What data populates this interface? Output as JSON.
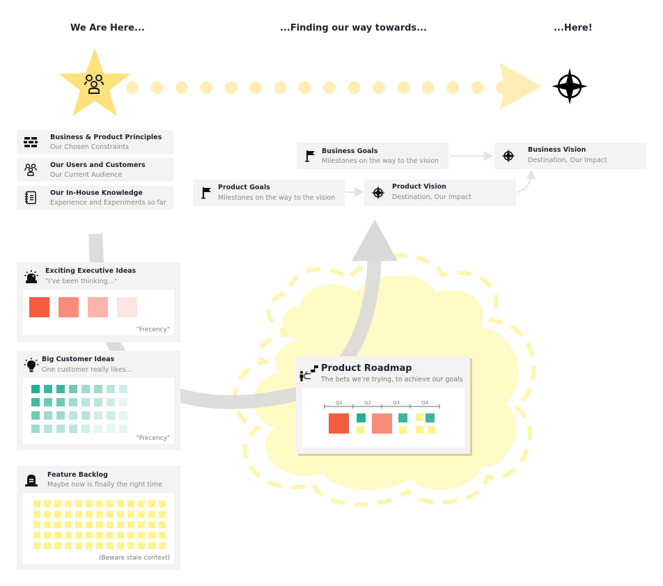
{
  "headings": {
    "left": "We Are Here...",
    "middle": "...Finding our way towards...",
    "right": "...Here!"
  },
  "icons": {
    "start": "group-of-people-icon",
    "destination": "compass-rose-icon"
  },
  "colors": {
    "star": "#fde17a",
    "dots": "#fdeeb6",
    "cloud": "#fffac6",
    "cloud_dash": "#fff5ad",
    "card_bg": "#f3f3f3",
    "gray_arrow": "#d9d9d9",
    "exec_red": "#f55b3f",
    "teal": "#22ae92",
    "backlog_yellow": "#fff48c"
  },
  "context_cards": [
    {
      "icon": "brick-wall-icon",
      "title": "Business & Product Principles",
      "subtitle": "Our Chosen Constraints"
    },
    {
      "icon": "users-icon",
      "title": "Our Users and Customers",
      "subtitle": "Our Current Audience"
    },
    {
      "icon": "notebook-icon",
      "title": "Our In-House Knowledge",
      "subtitle": "Experience and Experiments so far"
    }
  ],
  "goal_cards": {
    "business_goals": {
      "icon": "flag-icon",
      "title": "Business Goals",
      "subtitle": "Milestones on the way to the vision"
    },
    "business_vision": {
      "icon": "compass-icon",
      "title": "Business Vision",
      "subtitle": "Destination, Our Impact"
    },
    "product_goals": {
      "icon": "flag-icon",
      "title": "Product Goals",
      "subtitle": "Milestones on the way to the vision"
    },
    "product_vision": {
      "icon": "compass-icon",
      "title": "Product Vision",
      "subtitle": "Destination, Our Impact"
    }
  },
  "idea_panels": {
    "executive": {
      "icon": "siren-icon",
      "title": "Exciting Executive Ideas",
      "subtitle": "\"I've been thinking...\"",
      "note": "\"Frecency\"",
      "items": [
        1.0,
        0.7,
        0.45,
        0.15
      ]
    },
    "customer": {
      "icon": "lightbulb-icon",
      "title": "Big Customer Ideas",
      "subtitle": "One customer really likes...",
      "note": "\"Frecency\"",
      "rows": [
        [
          1.0,
          0.88,
          0.88,
          0.65,
          0.45,
          0.45,
          0.32,
          0.22
        ],
        [
          0.88,
          0.65,
          0.65,
          0.45,
          0.32,
          0.32,
          0.22,
          0.12
        ],
        [
          0.65,
          0.45,
          0.45,
          0.32,
          0.32,
          0.22,
          0.22,
          0.12
        ],
        [
          0.45,
          0.32,
          0.32,
          0.32,
          0.22,
          0.12,
          0.12,
          0.12
        ]
      ]
    },
    "backlog": {
      "icon": "tombstone-icon",
      "title": "Feature Backlog",
      "subtitle": "Maybe now is finally the right time",
      "note": "(Beware stale context)",
      "rows": 5,
      "cols": 13
    }
  },
  "roadmap": {
    "icon": "person-path-to-flag-icon",
    "title": "Product Roadmap",
    "subtitle": "The bets we're trying, to achieve our goals",
    "quarters": [
      "Q1",
      "Q2",
      "Q3",
      "Q4"
    ],
    "bets": [
      {
        "quarter": "Q1",
        "kind": "executive",
        "size": "large",
        "shade": 1.0
      },
      {
        "quarter": "Q2",
        "kind": "customer",
        "size": "small",
        "row": 0,
        "shade": 1.0
      },
      {
        "quarter": "Q2",
        "kind": "backlog",
        "size": "small",
        "row": 1
      },
      {
        "quarter": "Q2-Q3",
        "kind": "executive",
        "size": "large",
        "shade": 0.7
      },
      {
        "quarter": "Q3",
        "kind": "customer",
        "size": "small",
        "row": 0,
        "shade": 0.88
      },
      {
        "quarter": "Q3",
        "kind": "backlog",
        "size": "small",
        "row": 1
      },
      {
        "quarter": "Q4",
        "kind": "backlog",
        "size": "small",
        "row": 0
      },
      {
        "quarter": "Q4",
        "kind": "customer",
        "size": "small",
        "row": 0,
        "shade": 0.88
      },
      {
        "quarter": "Q4",
        "kind": "backlog",
        "size": "small",
        "row": 1
      },
      {
        "quarter": "Q4",
        "kind": "backlog",
        "size": "small",
        "row": 1
      }
    ]
  }
}
